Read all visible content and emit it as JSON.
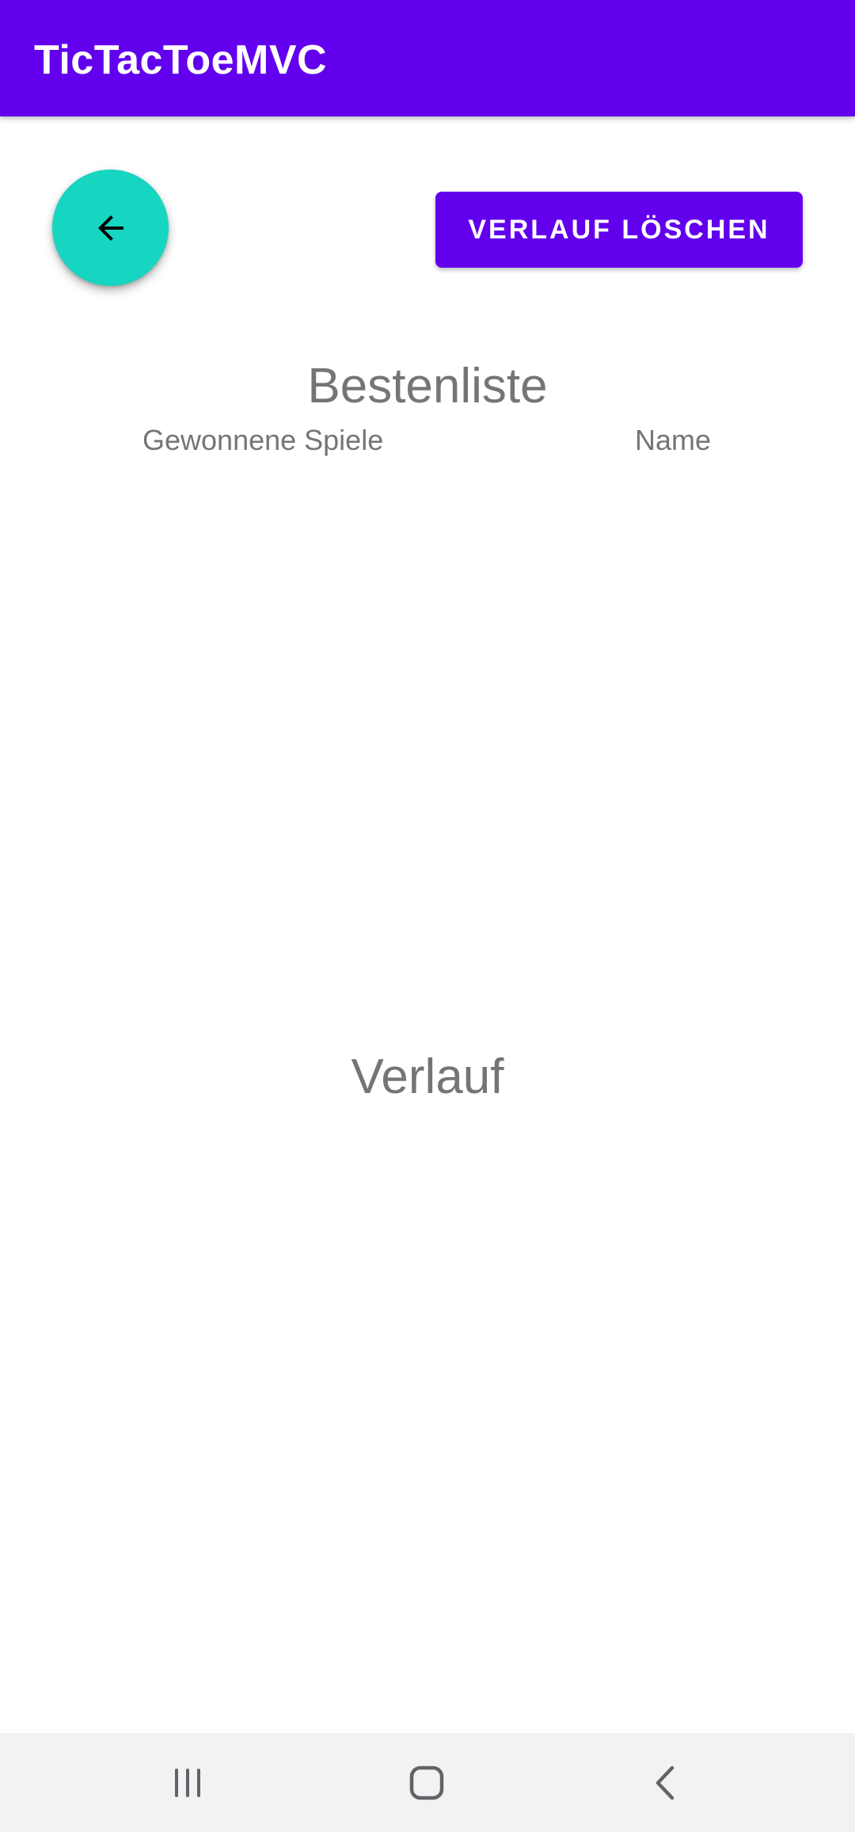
{
  "app_bar": {
    "title": "TicTacToeMVC"
  },
  "actions": {
    "back_icon": "arrow-left-icon",
    "clear_history_label": "VERLAUF LÖSCHEN"
  },
  "leaderboard": {
    "title": "Bestenliste",
    "columns": [
      "Gewonnene Spiele",
      "Name"
    ],
    "rows": []
  },
  "history": {
    "title": "Verlauf",
    "entries": []
  },
  "system_nav": {
    "items": [
      "recent-apps-icon",
      "home-icon",
      "back-chevron-icon"
    ]
  },
  "colors": {
    "primary": "#6200ee",
    "accent": "#16d5c1",
    "text_secondary": "#757575",
    "nav_background": "#f2f2f2"
  }
}
